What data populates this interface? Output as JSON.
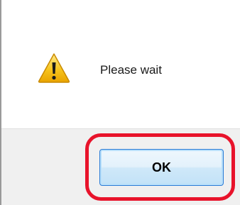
{
  "dialog": {
    "message": "Please wait",
    "icon": "warning-icon",
    "ok_label": "OK",
    "accent_color": "#e8132b"
  }
}
